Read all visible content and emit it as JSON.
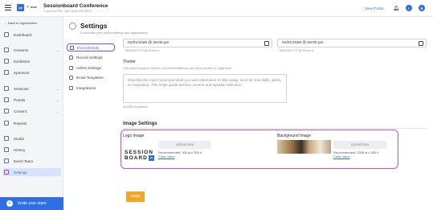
{
  "header": {
    "logo_text": "sb",
    "plus": "+",
    "partner": "mxe",
    "title": "Sessionboard Conference",
    "date": "3 Jan 5:00 PM - Jan 7 6:00 PM (PDT)",
    "view_portal": "View Portal",
    "help": "?",
    "user_initial": "B"
  },
  "sidebar": {
    "back": "← Back to organization",
    "items": [
      {
        "label": "Dashboard"
      },
      {
        "label": "Contacts"
      },
      {
        "label": "Exhibitors"
      },
      {
        "label": "Sponsors"
      },
      {
        "label": "Sessions"
      },
      {
        "label": "Portals"
      },
      {
        "label": "Content"
      },
      {
        "label": "Reports"
      },
      {
        "label": "Studio"
      },
      {
        "label": "History"
      },
      {
        "label": "Event Team"
      },
      {
        "label": "Settings"
      }
    ],
    "invite": "Invite your team"
  },
  "settings": {
    "title": "Settings",
    "description": "Customize your event settings and appearance",
    "nav": [
      {
        "label": "Event Details"
      },
      {
        "label": "Record Settings"
      },
      {
        "label": "Admin Settings"
      },
      {
        "label": "Email Templates"
      },
      {
        "label": "Integrations"
      }
    ]
  },
  "form": {
    "start_datetime": "01/01/2026 @ 05:00 pm",
    "end_datetime": "01/01/2026 @ 06:00 pm",
    "date_hint": "MM/DD/YYYY @ hh:mm a",
    "theme_label": "Theme",
    "theme_help": "This helps improve search, recommendations, and how content is organized.",
    "theme_placeholder": "Describe the main focus and what you want attendees to take away, such as new skills, ideas, or inspiration. This helps guide session content and speaker selection.",
    "char_count": "0/1000 Characters",
    "image_settings_title": "Image Settings",
    "logo_label": "Logo Image",
    "logo_upload": "Upload New",
    "logo_rec": "Recommended: 300 w x 300 h",
    "logo_clear": "Clear Value",
    "logo_word1": "SESSION",
    "logo_word2": "BOARD",
    "logo_badge": "sb",
    "bg_label": "Background Image",
    "bg_upload": "Upload New",
    "bg_rec": "Recommended: 1500 w x 500 h",
    "bg_clear": "Clear Value",
    "save": "Save"
  }
}
